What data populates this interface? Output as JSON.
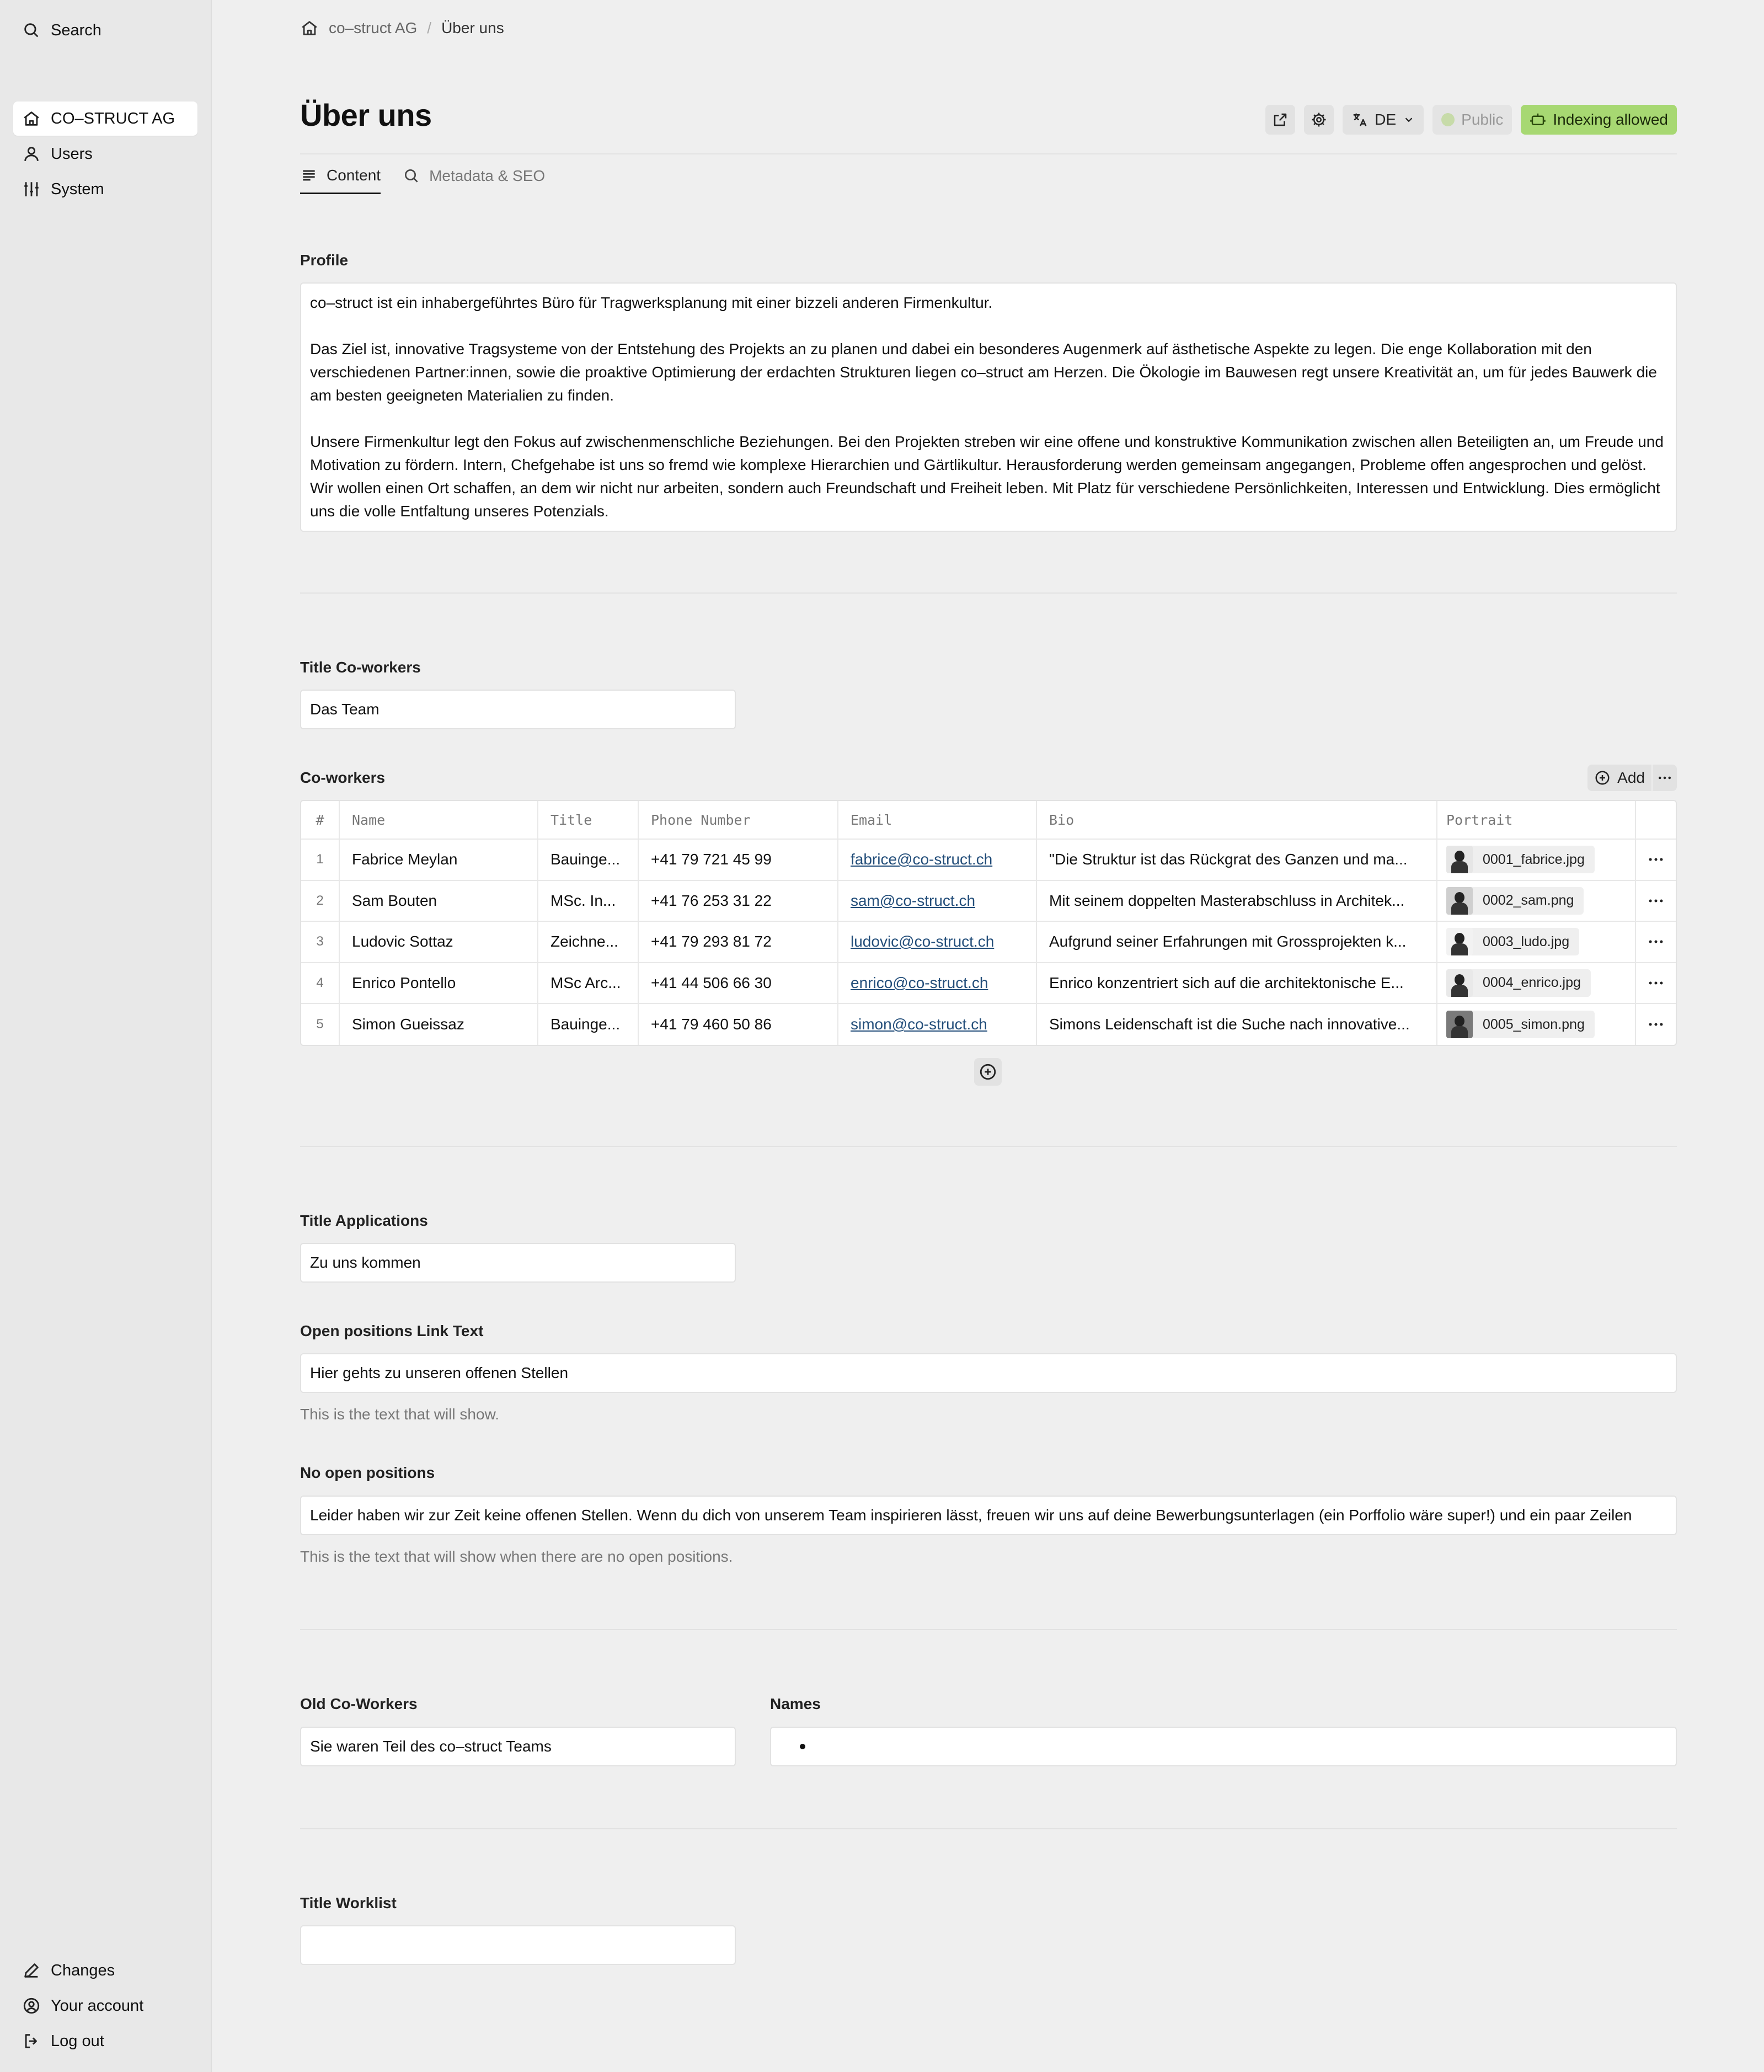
{
  "sidebar": {
    "search_label": "Search",
    "items": [
      {
        "label": "CO–STRUCT AG",
        "icon": "home-icon",
        "active": true
      },
      {
        "label": "Users",
        "icon": "user-icon"
      },
      {
        "label": "System",
        "icon": "sliders-icon"
      }
    ],
    "bottom": [
      {
        "label": "Changes",
        "icon": "pencil-icon"
      },
      {
        "label": "Your account",
        "icon": "account-icon"
      },
      {
        "label": "Log out",
        "icon": "logout-icon"
      }
    ]
  },
  "breadcrumb": {
    "root": "co–struct AG",
    "separator": "/",
    "current": "Über uns"
  },
  "page": {
    "title": "Über uns",
    "language": "DE",
    "status": "Public",
    "indexing": "Indexing allowed",
    "colors": {
      "indexing_bg": "#a7d872",
      "public_dot": "#c7dba9"
    }
  },
  "tabs": [
    {
      "label": "Content",
      "icon": "lines-icon",
      "active": true
    },
    {
      "label": "Metadata & SEO",
      "icon": "search-icon",
      "active": false
    }
  ],
  "profile": {
    "label": "Profile",
    "paragraphs": [
      "co–struct ist ein inhabergeführtes Büro für Tragwerksplanung mit einer bizzeli anderen Firmenkultur.",
      "Das Ziel ist, innovative Tragsysteme von der Entstehung des Projekts an zu planen und dabei ein besonderes Augenmerk auf ästhetische Aspekte zu legen. Die enge Kollaboration mit den verschiedenen Partner:innen, sowie die proaktive Optimierung der erdachten Strukturen liegen co–struct am Herzen. Die Ökologie im Bauwesen regt unsere Kreativität an, um für jedes Bauwerk die am besten geeigneten Materialien zu finden.",
      "Unsere Firmenkultur legt den Fokus auf zwischenmenschliche Beziehungen. Bei den Projekten streben wir eine offene und konstruktive Kommunikation zwischen allen Beteiligten an, um Freude und Motivation zu fördern. Intern, Chefgehabe ist uns so fremd wie komplexe Hierarchien und Gärtlikultur. Herausforderung werden gemeinsam angegangen, Probleme offen angesprochen und gelöst. Wir wollen einen Ort schaffen, an dem wir nicht nur arbeiten, sondern auch Freundschaft und Freiheit leben. Mit Platz für verschiedene Persönlichkeiten, Interessen und Entwicklung. Dies ermöglicht uns die volle Entfaltung unseres Potenzials."
    ]
  },
  "title_coworkers": {
    "label": "Title Co-workers",
    "value": "Das Team"
  },
  "coworkers": {
    "label": "Co-workers",
    "add_label": "Add",
    "columns": [
      "#",
      "Name",
      "Title",
      "Phone Number",
      "Email",
      "Bio",
      "Portrait"
    ],
    "rows": [
      {
        "idx": "1",
        "name": "Fabrice Meylan",
        "title": "Bauinge...",
        "phone": "+41 79 721 45 99",
        "email": "fabrice@co-struct.ch",
        "bio": "\"Die Struktur ist das Rückgrat des Ganzen und ma...",
        "portrait": "0001_fabrice.jpg"
      },
      {
        "idx": "2",
        "name": "Sam Bouten",
        "title": "MSc. In...",
        "phone": "+41 76 253 31 22",
        "email": "sam@co-struct.ch",
        "bio": "Mit seinem doppelten Masterabschluss in Architek...",
        "portrait": "0002_sam.png"
      },
      {
        "idx": "3",
        "name": "Ludovic Sottaz",
        "title": "Zeichne...",
        "phone": "+41 79 293 81 72",
        "email": "ludovic@co-struct.ch",
        "bio": "Aufgrund seiner Erfahrungen mit Grossprojekten k...",
        "portrait": "0003_ludo.jpg"
      },
      {
        "idx": "4",
        "name": "Enrico Pontello",
        "title": "MSc Arc...",
        "phone": "+41 44 506 66 30",
        "email": "enrico@co-struct.ch",
        "bio": "Enrico konzentriert sich auf die architektonische E...",
        "portrait": "0004_enrico.jpg"
      },
      {
        "idx": "5",
        "name": "Simon Gueissaz",
        "title": "Bauinge...",
        "phone": "+41 79 460 50 86",
        "email": "simon@co-struct.ch",
        "bio": "Simons Leidenschaft ist die Suche nach innovative...",
        "portrait": "0005_simon.png"
      }
    ]
  },
  "title_applications": {
    "label": "Title Applications",
    "value": "Zu uns kommen"
  },
  "open_positions_link": {
    "label": "Open positions Link Text",
    "value": "Hier gehts zu unseren offenen Stellen",
    "help": "This is the text that will show."
  },
  "no_open_positions": {
    "label": "No open positions",
    "value": "Leider haben wir zur Zeit keine offenen Stellen. Wenn du dich von unserem Team inspirieren lässt, freuen wir uns auf deine Bewerbungsunterlagen (ein Porffolio wäre super!) und ein paar Zeilen",
    "help": "This is the text that will show when there are no open positions."
  },
  "old_coworkers": {
    "label": "Old Co-Workers",
    "value": "Sie waren Teil des co–struct Teams"
  },
  "names": {
    "label": "Names"
  },
  "title_worklist": {
    "label": "Title Worklist",
    "value": ""
  }
}
